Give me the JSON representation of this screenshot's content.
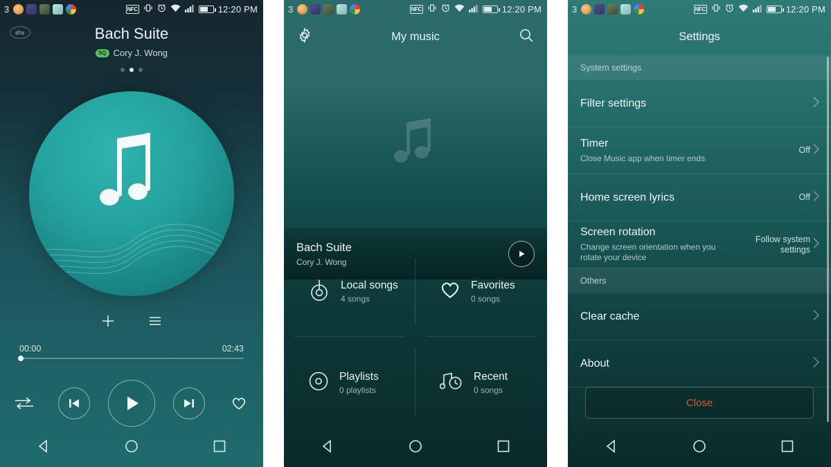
{
  "status_bar": {
    "notification_count": "3",
    "time": "12:20 PM",
    "icons": [
      "nfc-icon",
      "vibrate-icon",
      "alarm-icon",
      "wifi-icon",
      "signal-icon",
      "battery-icon"
    ],
    "app_icons": [
      "emoji-app-icon",
      "purple-app-icon",
      "olive-app-icon",
      "gallery-app-icon",
      "chrome-app-icon"
    ]
  },
  "player": {
    "dts_badge": "dts",
    "track_title": "Bach Suite",
    "quality_badge": "SQ",
    "artist": "Cory J. Wong",
    "page_dots": {
      "total": 3,
      "active": 2
    },
    "album_art_icon": "music-note-icon",
    "add_icon": "plus-icon",
    "queue_icon": "list-icon",
    "elapsed_time": "00:00",
    "total_time": "02:43",
    "progress_percent": 0,
    "shuffle_icon": "repeat-icon",
    "previous_icon": "skip-previous-icon",
    "play_icon": "play-icon",
    "next_icon": "skip-next-icon",
    "favorite_icon": "heart-icon"
  },
  "my_music": {
    "settings_icon": "gear-icon",
    "title": "My music",
    "search_icon": "search-icon",
    "watermark_icon": "music-note-icon",
    "now_playing": {
      "title": "Bach Suite",
      "artist": "Cory J. Wong",
      "play_icon": "play-circle-icon"
    },
    "cells": [
      {
        "icon": "beats-icon",
        "label": "Local songs",
        "sub": "4 songs"
      },
      {
        "icon": "heart-icon",
        "label": "Favorites",
        "sub": "0 songs"
      },
      {
        "icon": "disc-icon",
        "label": "Playlists",
        "sub": "0 playlists"
      },
      {
        "icon": "note-clock-icon",
        "label": "Recent",
        "sub": "0 songs"
      }
    ]
  },
  "settings": {
    "title": "Settings",
    "sections": [
      {
        "header": "System settings",
        "rows": [
          {
            "title": "Filter settings",
            "sub": "",
            "value": "",
            "chevron": "chevron-right-icon"
          },
          {
            "title": "Timer",
            "sub": "Close Music app when timer ends",
            "value": "Off",
            "chevron": "chevron-right-icon"
          },
          {
            "title": "Home screen lyrics",
            "sub": "",
            "value": "Off",
            "chevron": "chevron-right-icon"
          },
          {
            "title": "Screen rotation",
            "sub": "Change screen orientation when you rotate your device",
            "value": "Follow system settings",
            "chevron": "chevron-right-icon"
          }
        ]
      },
      {
        "header": "Others",
        "rows": [
          {
            "title": "Clear cache",
            "sub": "",
            "value": "",
            "chevron": "chevron-right-icon"
          },
          {
            "title": "About",
            "sub": "",
            "value": "",
            "chevron": "chevron-right-icon"
          }
        ]
      }
    ],
    "close_label": "Close",
    "close_color": "#e2562a"
  },
  "nav_bar": {
    "back_icon": "back-triangle-icon",
    "home_icon": "home-circle-icon",
    "recents_icon": "recents-square-icon"
  }
}
